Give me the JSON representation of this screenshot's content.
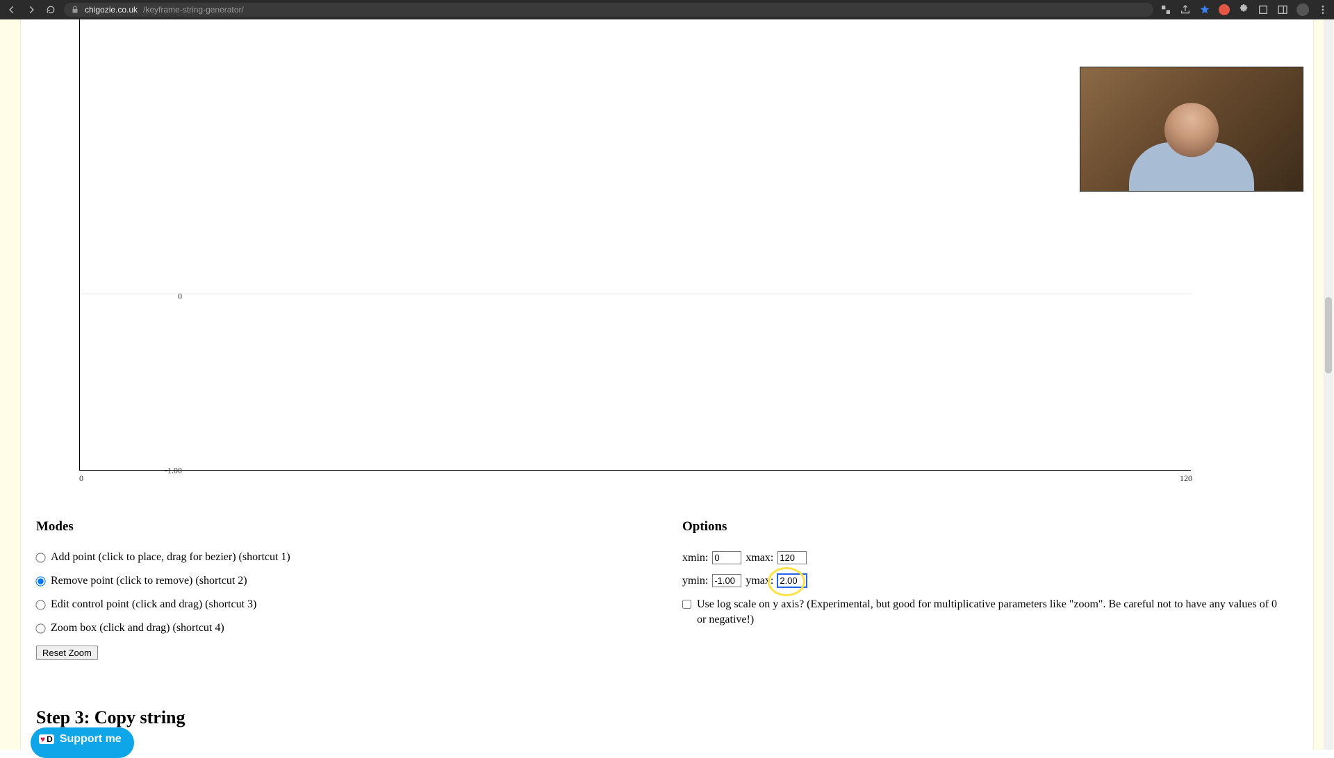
{
  "browser": {
    "url_host": "chigozie.co.uk",
    "url_path": "/keyframe-string-generator/"
  },
  "chart_data": {
    "type": "line",
    "series": [],
    "xlim": [
      0,
      120
    ],
    "ylim": [
      -1.0,
      2.0
    ],
    "y_ticks": [
      {
        "value": 0,
        "label": "0"
      },
      {
        "value": -1.0,
        "label": "-1.00"
      }
    ],
    "x_ticks": [
      {
        "value": 0,
        "label": "0"
      },
      {
        "value": 120,
        "label": "120"
      }
    ]
  },
  "modes": {
    "title": "Modes",
    "items": [
      {
        "label": "Add point (click to place, drag for bezier) (shortcut 1)",
        "checked": false
      },
      {
        "label": "Remove point (click to remove) (shortcut 2)",
        "checked": true
      },
      {
        "label": "Edit control point (click and drag) (shortcut 3)",
        "checked": false
      },
      {
        "label": "Zoom box (click and drag) (shortcut 4)",
        "checked": false
      }
    ],
    "reset_label": "Reset Zoom"
  },
  "options": {
    "title": "Options",
    "xmin_label": "xmin:",
    "xmin_value": "0",
    "xmax_label": "xmax:",
    "xmax_value": "120",
    "ymin_label": "ymin:",
    "ymin_value": "-1.00",
    "ymax_label": "ymax:",
    "ymax_value": "2.00",
    "log_label": "Use log scale on y axis? (Experimental, but good for multiplicative parameters like \"zoom\". Be careful not to have any values of 0 or negative!)",
    "log_checked": false
  },
  "step3_heading": "Step 3: Copy string",
  "support_label": "Support me"
}
